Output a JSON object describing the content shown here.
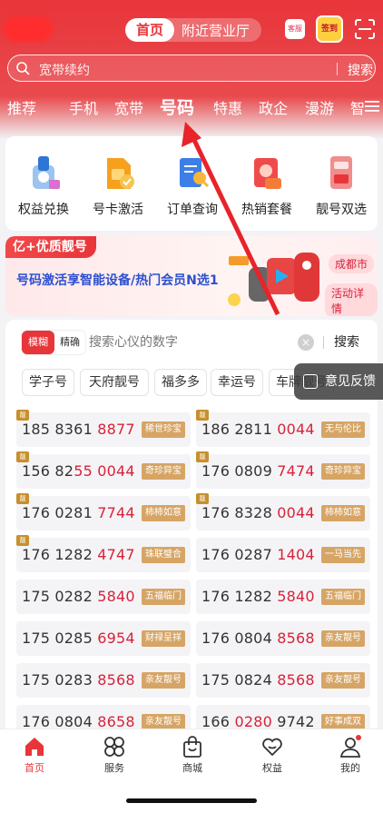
{
  "header": {
    "tab_home": "首页",
    "tab_nearby": "附近营业厅",
    "kefu_label": "客服",
    "sign_label": "签到"
  },
  "search": {
    "placeholder": "宽带续约",
    "button": "搜索"
  },
  "tabs": [
    {
      "label": "推荐"
    },
    {
      "label": "手机"
    },
    {
      "label": "宽带"
    },
    {
      "label": "号码",
      "active": true
    },
    {
      "label": "特惠"
    },
    {
      "label": "政企"
    },
    {
      "label": "漫游"
    },
    {
      "label": "智"
    }
  ],
  "shortcuts": [
    {
      "label": "权益兑换",
      "icon": "gift-icon"
    },
    {
      "label": "号卡激活",
      "icon": "sim-card-icon"
    },
    {
      "label": "订单查询",
      "icon": "order-search-icon"
    },
    {
      "label": "热销套餐",
      "icon": "package-icon"
    },
    {
      "label": "靓号双选",
      "icon": "number-select-icon"
    }
  ],
  "promo": {
    "tag": "亿+优质靓号",
    "text": "号码激活享智能设备/热门会员N选1",
    "city": "成都市",
    "detail": "活动详情"
  },
  "number_panel": {
    "mode_fuzzy": "模糊",
    "mode_exact": "精确",
    "search_placeholder": "搜索心仪的数字",
    "search_button": "搜索",
    "chips": [
      "学子号",
      "天府靓号",
      "福多多",
      "幸运号",
      "车牌靓号"
    ],
    "feedback": "意见反馈",
    "numbers": [
      {
        "pre": "185 8361 ",
        "red": "8877",
        "label": "稀世珍宝",
        "badge": "靓"
      },
      {
        "pre": "186 2811 ",
        "red": "0044",
        "label": "无与伦比",
        "badge": "靓"
      },
      {
        "pre": "156 82",
        "red": "55 0044",
        "label": "奇珍异宝",
        "badge": "靓"
      },
      {
        "pre": "176 0809 ",
        "red": "7474",
        "label": "奇珍异宝",
        "badge": "靓"
      },
      {
        "pre": "176 0281 ",
        "red": "7744",
        "label": "柿柿如意",
        "badge": "靓"
      },
      {
        "pre": "176 8328 ",
        "red": "0044",
        "label": "柿柿如意",
        "badge": "靓"
      },
      {
        "pre": "176 1282 ",
        "red": "4747",
        "label": "珠联璧合",
        "badge": "靓"
      },
      {
        "pre": "176 0287 ",
        "red": "1404",
        "label": "一马当先",
        "badge": ""
      },
      {
        "pre": "175 0282 ",
        "red": "5840",
        "label": "五福临门",
        "badge": ""
      },
      {
        "pre": "176 1282 ",
        "red": "5840",
        "label": "五福临门",
        "badge": ""
      },
      {
        "pre": "175 0285 ",
        "red": "6954",
        "label": "财禄呈祥",
        "badge": ""
      },
      {
        "pre": "176 0804 ",
        "red": "8568",
        "label": "亲友靓号",
        "badge": ""
      },
      {
        "pre": "175 0283 ",
        "red": "8568",
        "label": "亲友靓号",
        "badge": ""
      },
      {
        "pre": "175 0824 ",
        "red": "8568",
        "label": "亲友靓号",
        "badge": ""
      },
      {
        "pre": "176 0804 ",
        "red": "8658",
        "label": "亲友靓号",
        "badge": ""
      },
      {
        "pre": "166 ",
        "red": "0280",
        "post": " 9742",
        "label": "好事成双",
        "badge": ""
      }
    ]
  },
  "bottom_nav": [
    {
      "label": "首页",
      "active": true
    },
    {
      "label": "服务"
    },
    {
      "label": "商城"
    },
    {
      "label": "权益"
    },
    {
      "label": "我的"
    }
  ],
  "colors": {
    "brand_red": "#e8353a",
    "gold_label": "#d6a565",
    "promo_blue": "#2d4fd1"
  }
}
